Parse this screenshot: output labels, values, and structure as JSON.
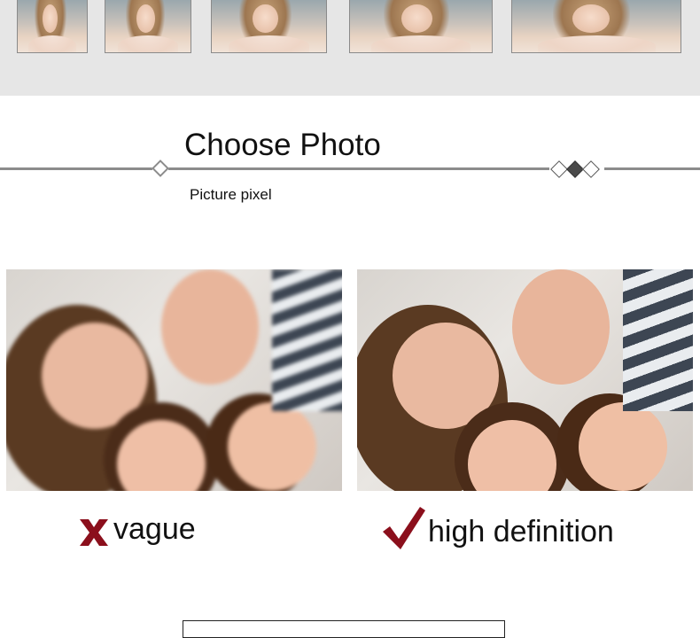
{
  "header": {
    "title": "Choose Photo",
    "subtitle": "Picture pixel"
  },
  "comparison": {
    "left_label": "vague",
    "right_label": "high definition"
  },
  "colors": {
    "band_background": "#e6e6e6",
    "line_gray": "#8c8c8c",
    "mark_red": "#8b0f1c"
  },
  "icons": {
    "bad": "x-icon",
    "good": "checkmark-icon"
  }
}
